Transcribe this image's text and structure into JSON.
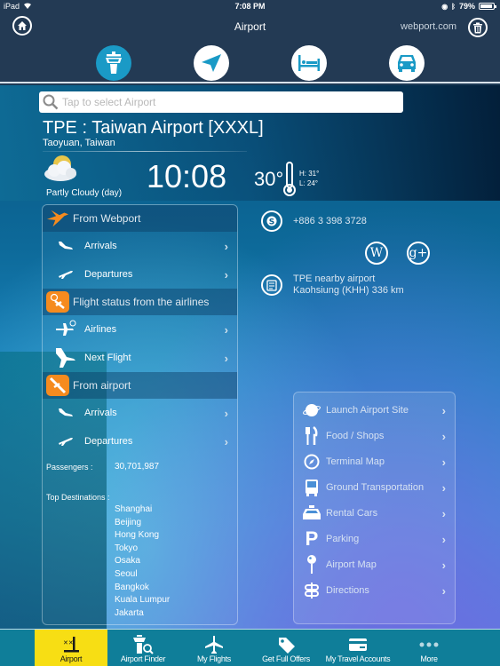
{
  "status_bar": {
    "device": "iPad",
    "time": "7:08 PM",
    "battery": "79%"
  },
  "nav": {
    "title": "Airport",
    "link": "webport.com"
  },
  "category_tabs": [
    {
      "name": "airport",
      "icon": "control-tower-icon",
      "active": true
    },
    {
      "name": "flights",
      "icon": "paper-plane-icon",
      "active": false
    },
    {
      "name": "hotels",
      "icon": "bed-icon",
      "active": false
    },
    {
      "name": "cars",
      "icon": "car-icon",
      "active": false
    }
  ],
  "search": {
    "placeholder": "Tap to select Airport",
    "value": ""
  },
  "airport": {
    "title": "TPE : Taiwan Airport [XXXL]",
    "location": "Taoyuan, Taiwan"
  },
  "weather": {
    "condition": "Partly Cloudy (day)",
    "local_time": "10:08",
    "temperature": "30°",
    "high": "H: 31°",
    "low": "L: 24°"
  },
  "left_panel": {
    "sections": [
      {
        "header": "From Webport",
        "items": [
          {
            "label": "Arrivals",
            "icon": "arrival-plane-icon"
          },
          {
            "label": "Departures",
            "icon": "departure-plane-icon"
          }
        ]
      },
      {
        "header": "Flight status from the airlines",
        "items": [
          {
            "label": "Airlines",
            "icon": "plane-clock-icon"
          },
          {
            "label": "Next Flight",
            "icon": "plane-icon"
          }
        ]
      },
      {
        "header": "From airport",
        "items": [
          {
            "label": "Arrivals",
            "icon": "arrival-plane-icon"
          },
          {
            "label": "Departures",
            "icon": "departure-plane-icon"
          }
        ]
      }
    ],
    "passengers_label": "Passengers :",
    "passengers_value": "30,701,987",
    "destinations_label": "Top  Destinations :",
    "destinations": [
      "Shanghai",
      "Beijing",
      "Hong Kong",
      "Tokyo",
      "Osaka",
      "Seoul",
      "Bangkok",
      "Kuala Lumpur",
      "Jakarta"
    ]
  },
  "contact": {
    "phone": "+886 3 398 3728",
    "nearby_line1": "TPE nearby airport",
    "nearby_line2": "Kaohsiung (KHH) 336 km",
    "wiki_label": "W",
    "gplus_label": "g+"
  },
  "services": [
    {
      "label": "Launch Airport Site",
      "icon": "globe-icon"
    },
    {
      "label": "Food / Shops",
      "icon": "fork-knife-icon"
    },
    {
      "label": "Terminal Map",
      "icon": "compass-icon"
    },
    {
      "label": "Ground Transportation",
      "icon": "bus-icon"
    },
    {
      "label": "Rental Cars",
      "icon": "taxi-icon"
    },
    {
      "label": "Parking",
      "icon": "parking-icon"
    },
    {
      "label": "Airport Map",
      "icon": "map-pin-icon"
    },
    {
      "label": "Directions",
      "icon": "signpost-icon"
    }
  ],
  "tab_bar": [
    {
      "label": "Airport",
      "active": true
    },
    {
      "label": "Airport Finder",
      "active": false
    },
    {
      "label": "My Flights",
      "active": false
    },
    {
      "label": "Get Full Offers",
      "active": false
    },
    {
      "label": "My Travel Accounts",
      "active": false
    },
    {
      "label": "More",
      "active": false
    }
  ],
  "colors": {
    "header_bg": "#233a54",
    "accent_blue": "#1a9ac6",
    "orange": "#f58b1f",
    "tab_bar_bg": "#0f7e99",
    "tab_active": "#f7de14"
  }
}
